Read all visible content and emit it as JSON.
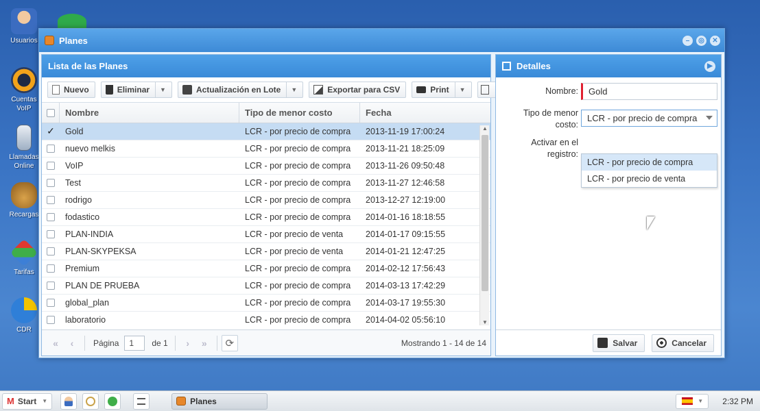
{
  "desktop": {
    "icons": [
      {
        "label": "Usuarios"
      },
      {
        "label": "Cuentas VoIP"
      },
      {
        "label": "Llamadas Online"
      },
      {
        "label": "Recargas"
      },
      {
        "label": "Tarifas"
      },
      {
        "label": "CDR"
      }
    ]
  },
  "window": {
    "title": "Planes"
  },
  "list_panel": {
    "title": "Lista de las Planes",
    "toolbar": {
      "new": "Nuevo",
      "delete": "Eliminar",
      "batch_update": "Actualización en Lote",
      "export_csv": "Exportar para CSV",
      "print": "Print"
    },
    "columns": {
      "name": "Nombre",
      "tipo": "Tipo de menor costo",
      "fecha": "Fecha"
    },
    "rows": [
      {
        "name": "Gold",
        "tipo": "LCR - por precio de compra",
        "fecha": "2013-11-19 17:00:24",
        "selected": true
      },
      {
        "name": "nuevo melkis",
        "tipo": "LCR - por precio de compra",
        "fecha": "2013-11-21 18:25:09"
      },
      {
        "name": "VoIP",
        "tipo": "LCR - por precio de compra",
        "fecha": "2013-11-26 09:50:48"
      },
      {
        "name": "Test",
        "tipo": "LCR - por precio de compra",
        "fecha": "2013-11-27 12:46:58"
      },
      {
        "name": "rodrigo",
        "tipo": "LCR - por precio de compra",
        "fecha": "2013-12-27 12:19:00"
      },
      {
        "name": "fodastico",
        "tipo": "LCR - por precio de compra",
        "fecha": "2014-01-16 18:18:55"
      },
      {
        "name": "PLAN-INDIA",
        "tipo": "LCR - por precio de venta",
        "fecha": "2014-01-17 09:15:55"
      },
      {
        "name": "PLAN-SKYPEKSA",
        "tipo": "LCR - por precio de venta",
        "fecha": "2014-01-21 12:47:25"
      },
      {
        "name": "Premium",
        "tipo": "LCR - por precio de compra",
        "fecha": "2014-02-12 17:56:43"
      },
      {
        "name": "PLAN DE PRUEBA",
        "tipo": "LCR - por precio de compra",
        "fecha": "2014-03-13 17:42:29"
      },
      {
        "name": "global_plan",
        "tipo": "LCR - por precio de compra",
        "fecha": "2014-03-17 19:55:30"
      },
      {
        "name": "laboratorio",
        "tipo": "LCR - por precio de compra",
        "fecha": "2014-04-02 05:56:10"
      }
    ],
    "pager": {
      "page_label": "Página",
      "page_value": "1",
      "of_label": "de 1",
      "status": "Mostrando 1 - 14 de 14"
    }
  },
  "detail_panel": {
    "title": "Detalles",
    "name_label": "Nombre:",
    "name_value": "Gold",
    "tipo_label": "Tipo de menor costo:",
    "tipo_value": "LCR - por precio de compra",
    "activar_label": "Activar en el registro:",
    "dropdown_options": [
      "LCR - por precio de compra",
      "LCR - por precio de venta"
    ],
    "save": "Salvar",
    "cancel": "Cancelar"
  },
  "taskbar": {
    "start": "Start",
    "task": "Planes",
    "clock": "2:32 PM"
  }
}
